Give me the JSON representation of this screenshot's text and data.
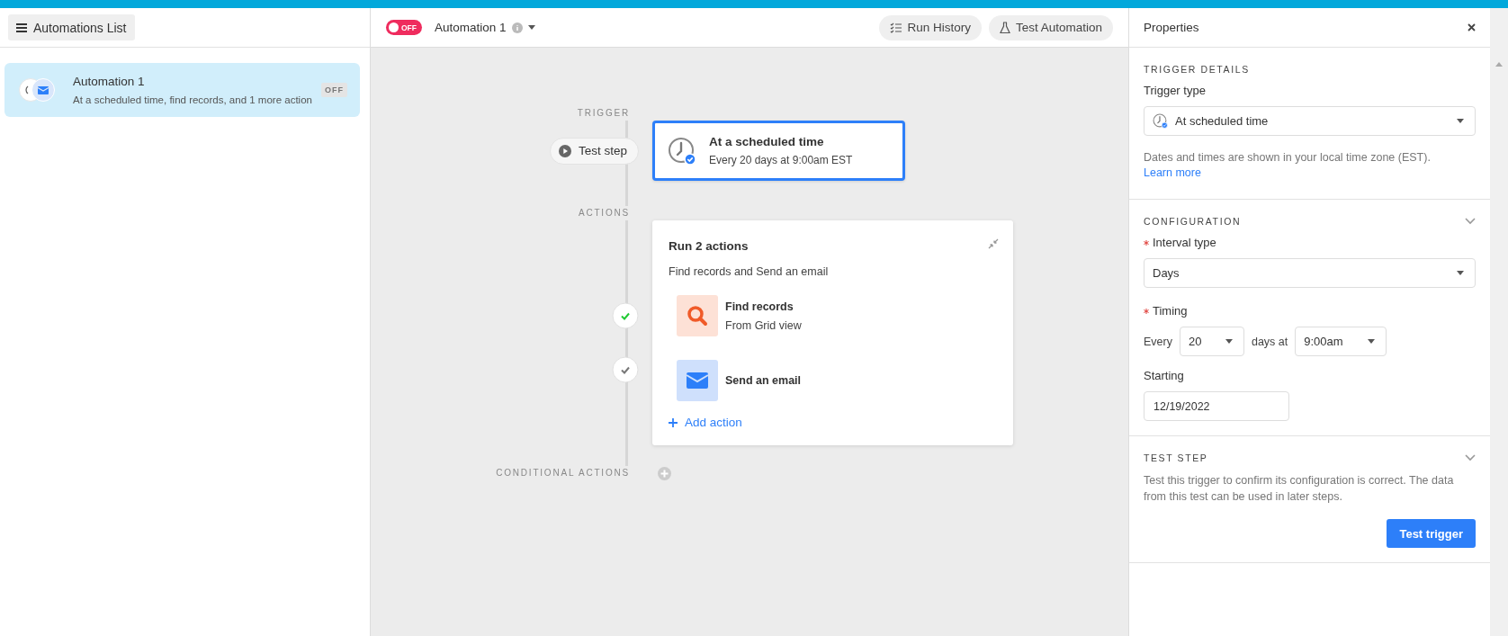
{
  "sidebar": {
    "header_button": "Automations List",
    "items": [
      {
        "title": "Automation 1",
        "description": "At a scheduled time, find records, and 1 more action",
        "status": "OFF",
        "selected": true
      }
    ]
  },
  "toolbar": {
    "toggle": {
      "label": "OFF",
      "on": false
    },
    "title": "Automation 1",
    "buttons": [
      {
        "kind": "history",
        "label": "Run History"
      },
      {
        "kind": "test",
        "label": "Test Automation"
      }
    ]
  },
  "flow": {
    "trigger_label": "TRIGGER",
    "test_step_button": "Test step",
    "trigger": {
      "title": "At a scheduled time",
      "subtitle": "Every 20 days at 9:00am EST",
      "selected": true
    },
    "actions_label": "ACTIONS",
    "actions_card": {
      "title": "Run 2 actions",
      "subtitle": "Find records and Send an email",
      "steps": [
        {
          "kind": "find",
          "title": "Find records",
          "subtitle": "From Grid view",
          "tested": true
        },
        {
          "kind": "email",
          "title": "Send an email",
          "tested": false
        }
      ],
      "add_action": "Add action"
    },
    "conditional_label": "CONDITIONAL ACTIONS"
  },
  "properties": {
    "title": "Properties",
    "trigger_details": {
      "heading": "TRIGGER DETAILS",
      "trigger_type_label": "Trigger type",
      "trigger_type_value": "At scheduled time",
      "note": "Dates and times are shown in your local time zone (EST).",
      "note_link": "Learn more"
    },
    "configuration": {
      "heading": "CONFIGURATION",
      "interval_label": "Interval type",
      "interval_required": true,
      "interval_value": "Days",
      "timing_label": "Timing",
      "timing_required": true,
      "every_label": "Every",
      "every_value": "20",
      "days_at_label": "days at",
      "time_value": "9:00am",
      "starting_label": "Starting",
      "starting_value": "12/19/2022"
    },
    "test_step": {
      "heading": "TEST STEP",
      "description": "Test this trigger to confirm its configuration is correct. The data from this test can be used in later steps.",
      "button": "Test trigger"
    }
  }
}
